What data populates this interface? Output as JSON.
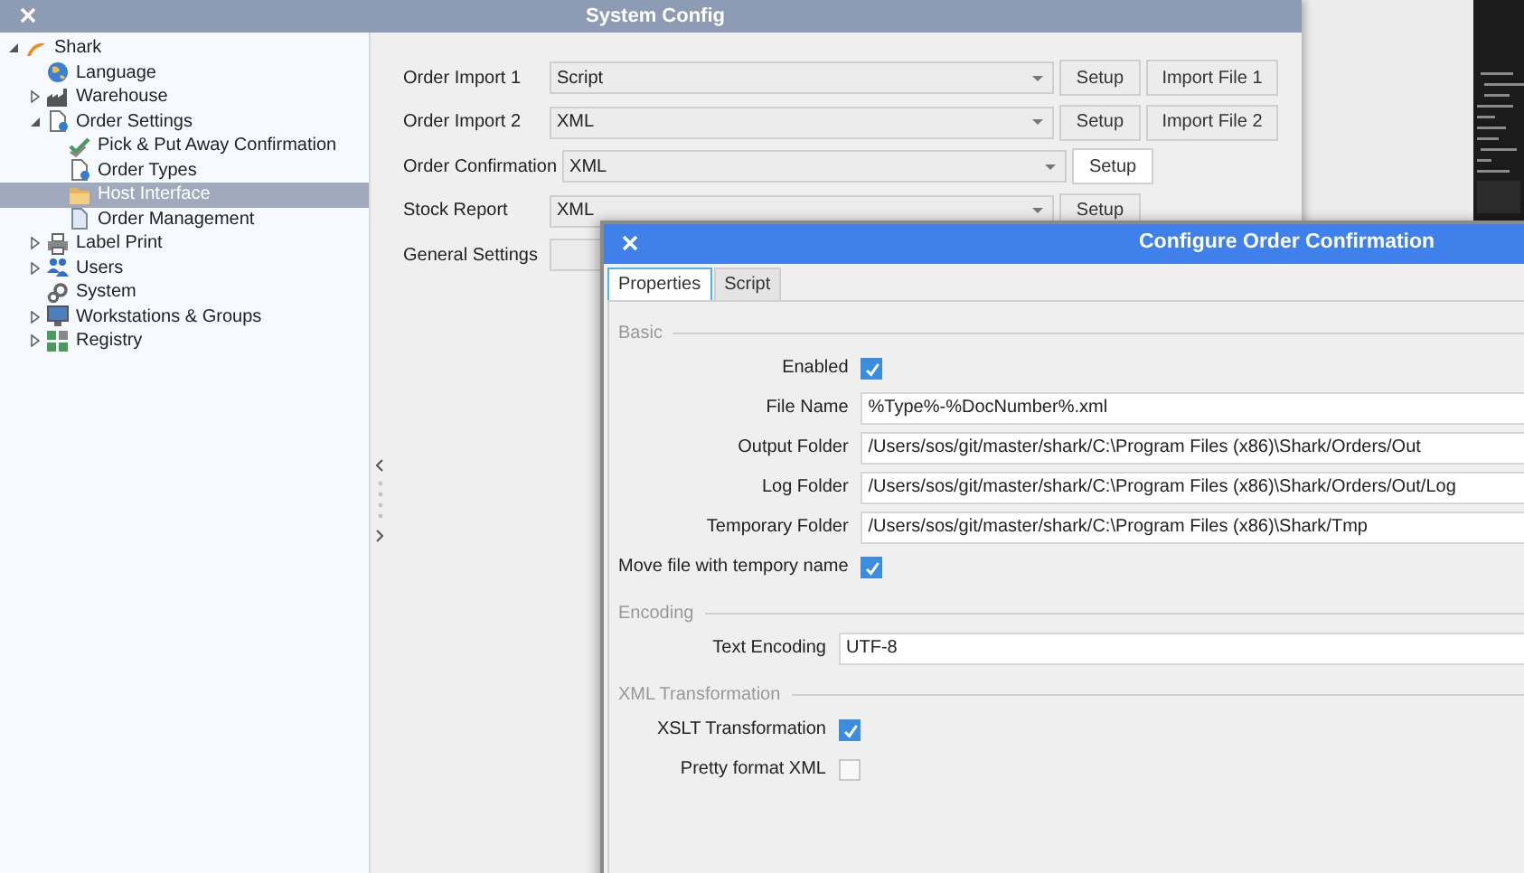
{
  "system_config": {
    "title": "System Config",
    "tree": [
      {
        "label": "Shark",
        "kind": "logo",
        "expanded": true,
        "selected": false,
        "children": [
          {
            "label": "Language",
            "kind": "globe",
            "selected": false
          },
          {
            "label": "Warehouse",
            "kind": "factory",
            "expanded": false,
            "selected": false
          },
          {
            "label": "Order Settings",
            "kind": "document-gear",
            "expanded": true,
            "selected": false,
            "children": [
              {
                "label": "Pick & Put Away Confirmation",
                "kind": "check",
                "selected": false
              },
              {
                "label": "Order Types",
                "kind": "document-gear",
                "selected": false
              },
              {
                "label": "Host Interface",
                "kind": "folder",
                "selected": true
              },
              {
                "label": "Order Management",
                "kind": "document",
                "selected": false
              }
            ]
          },
          {
            "label": "Label Print",
            "kind": "printer",
            "expanded": false,
            "selected": false
          },
          {
            "label": "Users",
            "kind": "users",
            "expanded": false,
            "selected": false
          },
          {
            "label": "System",
            "kind": "gears",
            "selected": false
          },
          {
            "label": "Workstations & Groups",
            "kind": "monitor",
            "expanded": false,
            "selected": false
          },
          {
            "label": "Registry",
            "kind": "blocks",
            "expanded": false,
            "selected": false
          }
        ]
      }
    ],
    "rows": [
      {
        "label": "Order Import 1",
        "kind": "combo",
        "value": "Script",
        "buttons": [
          {
            "label": "Setup",
            "active": false
          },
          {
            "label": "Import File 1",
            "active": false
          }
        ]
      },
      {
        "label": "Order Import 2",
        "kind": "combo",
        "value": "XML",
        "buttons": [
          {
            "label": "Setup",
            "active": false
          },
          {
            "label": "Import File 2",
            "active": false
          }
        ]
      },
      {
        "label": "Order Confirmation",
        "kind": "combo",
        "value": "XML",
        "buttons": [
          {
            "label": "Setup",
            "active": true
          }
        ]
      },
      {
        "label": "Stock Report",
        "kind": "combo",
        "value": "XML",
        "buttons": [
          {
            "label": "Setup",
            "active": false
          }
        ]
      },
      {
        "label": "General Settings",
        "kind": "field"
      }
    ]
  },
  "dialog": {
    "title": "Configure Order Confirmation",
    "tabs": [
      {
        "label": "Properties",
        "selected": true
      },
      {
        "label": "Script",
        "selected": false
      }
    ],
    "sections": [
      {
        "title": "Basic",
        "rows": [
          {
            "label": "Enabled",
            "kind": "checkbox",
            "checked": true
          },
          {
            "label": "File Name",
            "kind": "text",
            "value": "%Type%-%DocNumber%.xml"
          },
          {
            "label": "Output Folder",
            "kind": "text",
            "value": "/Users/sos/git/master/shark/C:\\Program Files (x86)\\Shark/Orders/Out"
          },
          {
            "label": "Log Folder",
            "kind": "text",
            "value": "/Users/sos/git/master/shark/C:\\Program Files (x86)\\Shark/Orders/Out/Log"
          },
          {
            "label": "Temporary Folder",
            "kind": "text",
            "value": "/Users/sos/git/master/shark/C:\\Program Files (x86)\\Shark/Tmp"
          },
          {
            "label": "Move file with tempory name",
            "kind": "checkbox",
            "checked": true
          }
        ]
      },
      {
        "title": "Encoding",
        "rows": [
          {
            "label": "Text Encoding",
            "kind": "text",
            "value": "UTF-8"
          }
        ]
      },
      {
        "title": "XML Transformation",
        "rows": [
          {
            "label": "XSLT Transformation",
            "kind": "checkbox",
            "checked": true
          },
          {
            "label": "Pretty format XML",
            "kind": "checkbox",
            "checked": false
          }
        ]
      }
    ]
  }
}
